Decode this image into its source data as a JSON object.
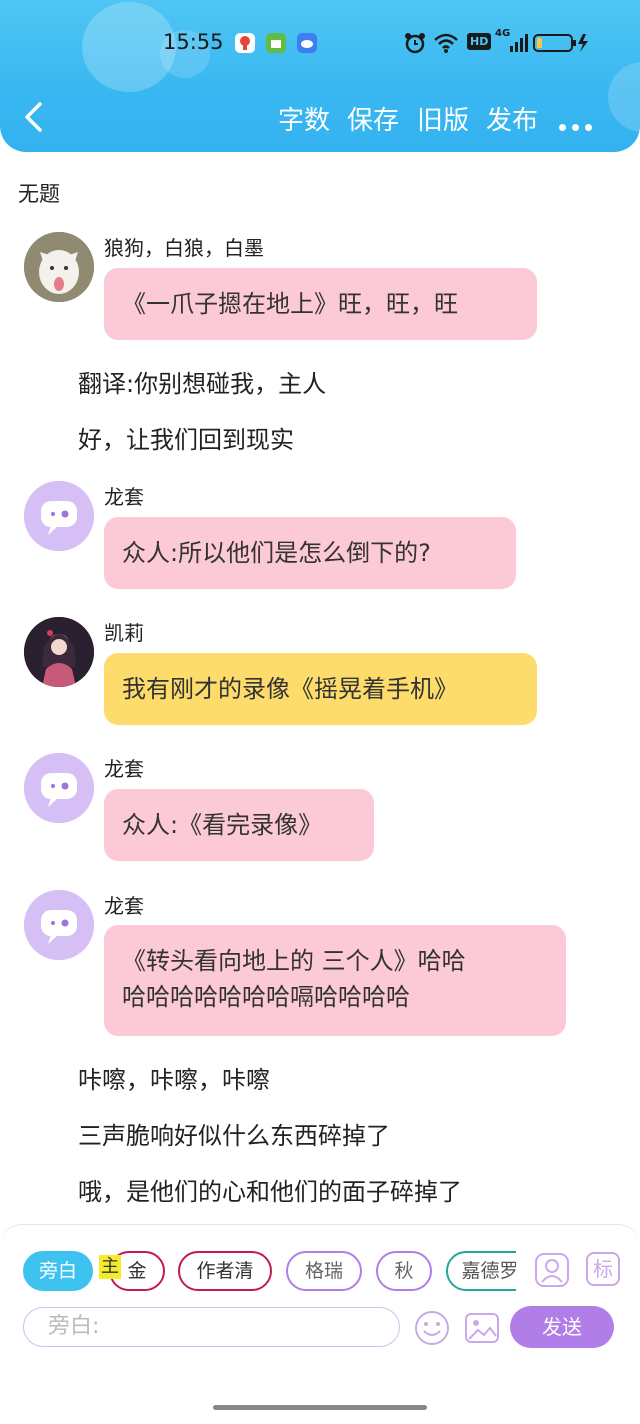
{
  "status_bar": {
    "time": "15:55",
    "hd_label": "HD",
    "network_label": "4G"
  },
  "toolbar": {
    "word_count": "字数",
    "save": "保存",
    "old_version": "旧版",
    "publish": "发布"
  },
  "doc": {
    "title": "无题"
  },
  "messages": [
    {
      "type": "char",
      "name": "狼狗，白狼，白墨",
      "lines": [
        "《一爪子摁在地上》旺，旺，旺"
      ],
      "color": "pink"
    },
    {
      "type": "narration",
      "text": "翻译:你别想碰我，主人"
    },
    {
      "type": "narration",
      "text": "好，让我们回到现实"
    },
    {
      "type": "char",
      "name": "龙套",
      "lines": [
        "众人:所以他们是怎么倒下的?"
      ],
      "color": "pink"
    },
    {
      "type": "char",
      "name": "凯莉",
      "lines": [
        "我有刚才的录像《摇晃着手机》"
      ],
      "color": "yellow"
    },
    {
      "type": "char",
      "name": "龙套",
      "lines": [
        "众人:《看完录像》"
      ],
      "color": "pink"
    },
    {
      "type": "char",
      "name": "龙套",
      "lines": [
        "《转头看向地上的 三个人》哈哈",
        "哈哈哈哈哈哈哈嗝哈哈哈哈"
      ],
      "color": "pink"
    },
    {
      "type": "narration",
      "text": "咔嚓，咔嚓，咔嚓"
    },
    {
      "type": "narration",
      "text": "三声脆响好似什么东西碎掉了"
    },
    {
      "type": "narration",
      "text": "哦，是他们的心和他们的面子碎掉了"
    }
  ],
  "chips": {
    "narration": "旁白",
    "main_tag": "主",
    "gold": "金",
    "author": "作者清",
    "gerui": "格瑞",
    "qiu": "秋",
    "jiade": "嘉德罗"
  },
  "icons": {
    "tag_label": "标"
  },
  "input": {
    "placeholder": "旁白:"
  },
  "send_label": "发送",
  "colors": {
    "header": "#39b7f1",
    "pink_bubble": "#fcc9d6",
    "yellow_bubble": "#fddc6c",
    "send": "#b07ee6"
  }
}
